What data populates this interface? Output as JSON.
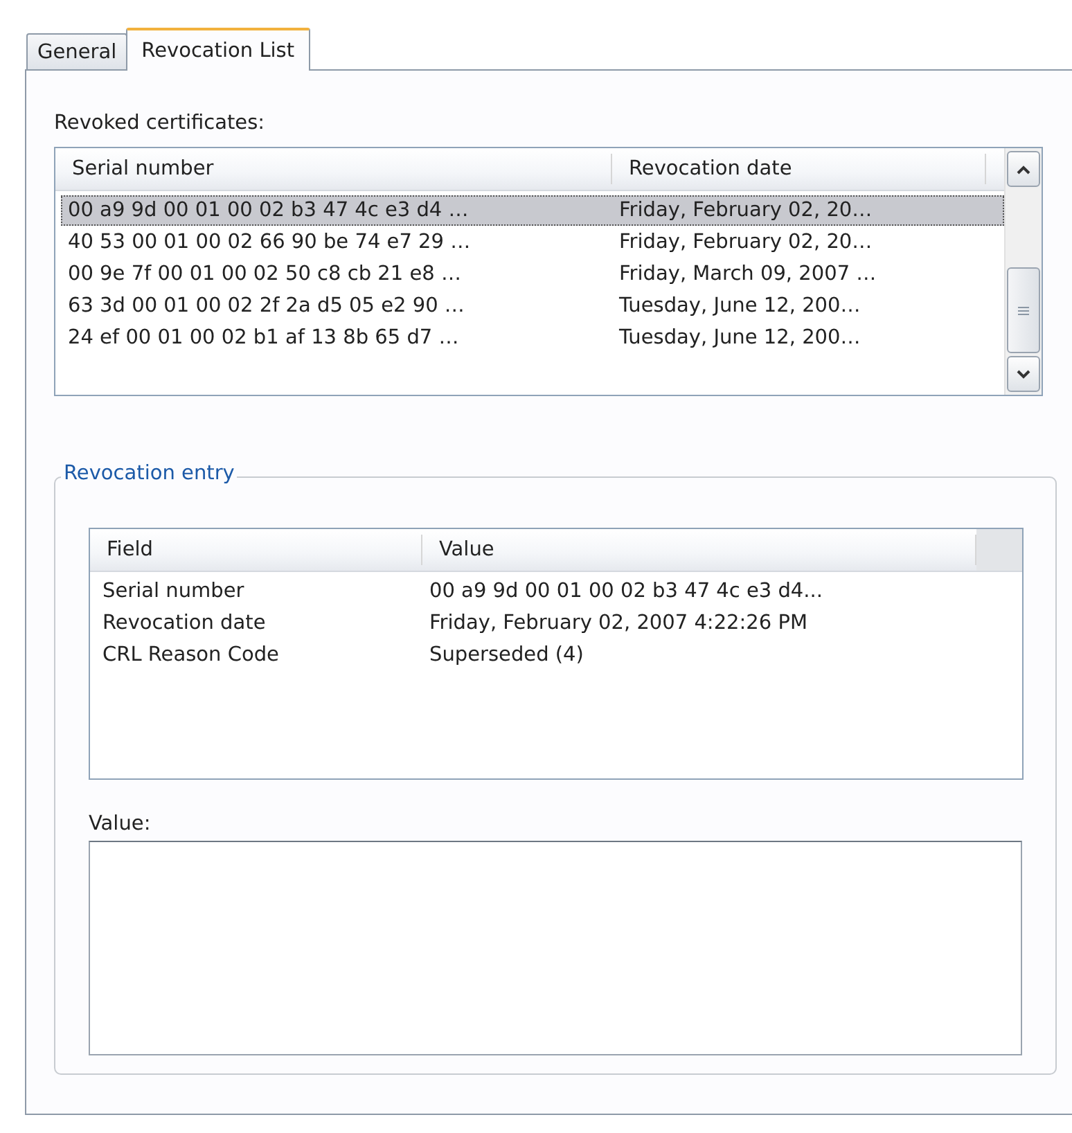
{
  "tabs": [
    {
      "label": "General",
      "selected": false
    },
    {
      "label": "Revocation List",
      "selected": true
    }
  ],
  "revoked_certificates": {
    "label": "Revoked certificates:",
    "columns": [
      "Serial number",
      "Revocation date"
    ],
    "rows": [
      {
        "cells": [
          "00 a9 9d 00 01 00 02 b3 47 4c e3 d4 …",
          "Friday, February 02, 20…"
        ],
        "selected": true
      },
      {
        "cells": [
          "40 53 00 01 00 02 66 90 be 74 e7 29 …",
          "Friday, February 02, 20…"
        ],
        "selected": false
      },
      {
        "cells": [
          "00 9e 7f 00 01 00 02 50 c8 cb 21 e8 …",
          "Friday, March 09, 2007 …"
        ],
        "selected": false
      },
      {
        "cells": [
          "63 3d 00 01 00 02 2f 2a d5 05 e2 90 …",
          "Tuesday, June 12, 200…"
        ],
        "selected": false
      },
      {
        "cells": [
          "24 ef 00 01 00 02 b1 af 13 8b 65 d7 …",
          "Tuesday, June 12, 200…"
        ],
        "selected": false
      }
    ]
  },
  "revocation_entry": {
    "title": "Revocation entry",
    "columns": [
      "Field",
      "Value"
    ],
    "rows": [
      {
        "cells": [
          "Serial number",
          "00 a9 9d 00 01 00 02 b3 47 4c e3 d4..."
        ],
        "selected": false
      },
      {
        "cells": [
          "Revocation date",
          "Friday, February 02, 2007 4:22:26 PM"
        ],
        "selected": false
      },
      {
        "cells": [
          "CRL Reason Code",
          "Superseded (4)"
        ],
        "selected": false
      }
    ],
    "value_label": "Value:"
  }
}
